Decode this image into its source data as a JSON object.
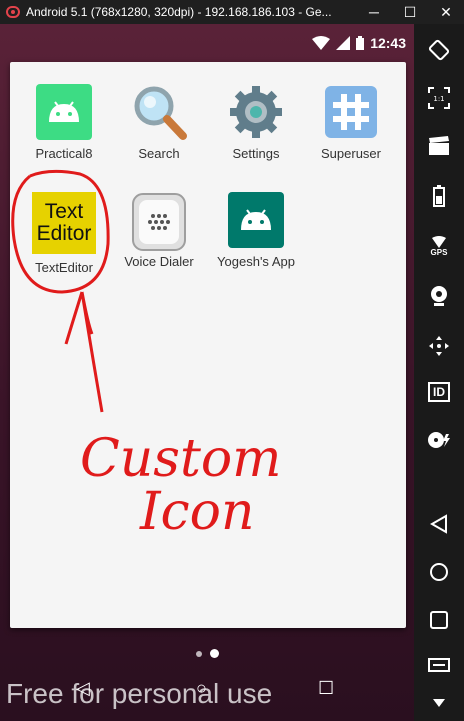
{
  "window": {
    "title": "Android 5.1 (768x1280, 320dpi) - 192.168.186.103 - Ge...",
    "minimize": "─",
    "maximize": "☐",
    "close": "✕"
  },
  "status": {
    "time": "12:43"
  },
  "apps": [
    {
      "label": "Practical8",
      "icon": "android-icon"
    },
    {
      "label": "Search",
      "icon": "magnifier-icon"
    },
    {
      "label": "Settings",
      "icon": "gear-icon"
    },
    {
      "label": "Superuser",
      "icon": "hash-icon"
    },
    {
      "label": "TextEditor",
      "icon": "text-editor-icon",
      "icon_text_1": "Text",
      "icon_text_2": "Editor"
    },
    {
      "label": "Voice Dialer",
      "icon": "speaker-icon"
    },
    {
      "label": "Yogesh's App",
      "icon": "android-icon"
    }
  ],
  "annotation": {
    "line1": "Custom",
    "line2": "Icon",
    "color": "#e01b1b"
  },
  "watermark": "Free for personal use",
  "sidebar": {
    "gps_label": "GPS",
    "id_label": "ID"
  }
}
